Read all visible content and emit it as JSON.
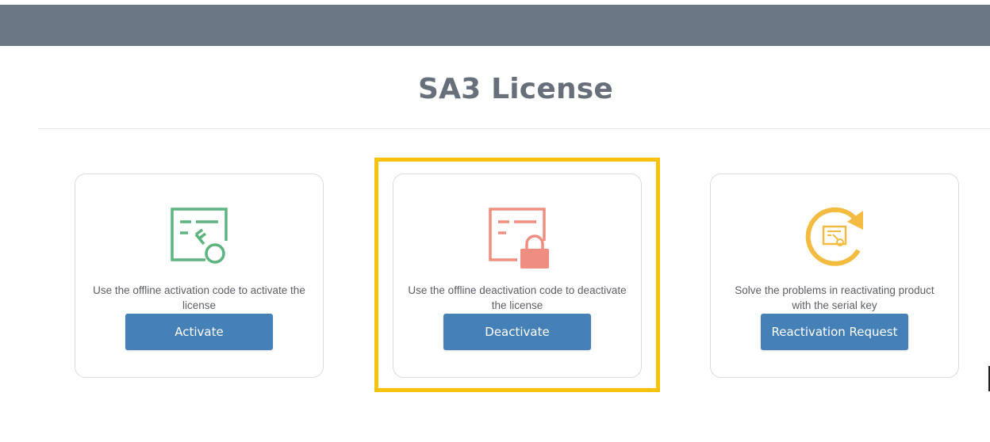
{
  "page": {
    "title": "SA3 License"
  },
  "cards": [
    {
      "icon": "certificate-key-icon",
      "description": "Use the offline activation code to activate the license",
      "button_label": "Activate"
    },
    {
      "icon": "certificate-lock-icon",
      "description": "Use the offline deactivation code to deactivate the license",
      "button_label": "Deactivate"
    },
    {
      "icon": "certificate-refresh-icon",
      "description": "Solve the problems in reactivating product with the serial key",
      "button_label": "Reactivation Request"
    }
  ],
  "colors": {
    "header_bar": "#6a7785",
    "button": "#4580b6",
    "activate_icon": "#5cb47e",
    "deactivate_icon": "#ef8d80",
    "reactivate_icon": "#f3bb3f",
    "highlight": "#f7c20d"
  }
}
